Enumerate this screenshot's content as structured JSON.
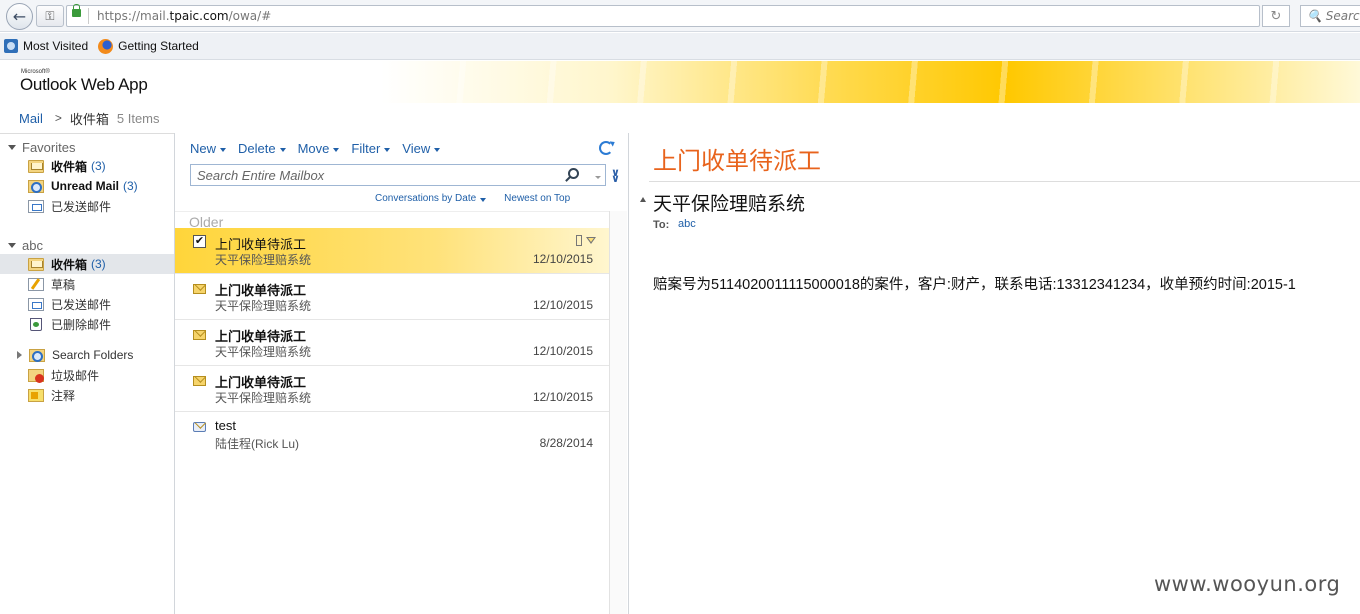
{
  "browser": {
    "url_prefix": "https://mail.",
    "url_domain": "tpaic.com",
    "url_suffix": "/owa/#",
    "search_placeholder": "Search",
    "bookmarks": [
      {
        "label": "Most Visited",
        "icon": "bookmark-icon"
      },
      {
        "label": "Getting Started",
        "icon": "firefox-icon"
      }
    ]
  },
  "owa": {
    "brand_small": "Microsoft®",
    "title": "Outlook Web App"
  },
  "breadcrumb": {
    "root": "Mail",
    "folder": "收件箱",
    "count": "5 Items"
  },
  "leftnav": {
    "favorites_header": "Favorites",
    "favorites": [
      {
        "label": "收件箱",
        "count": "(3)",
        "icon": "inbox-icon",
        "bold": true
      },
      {
        "label": "Unread Mail",
        "count": "(3)",
        "icon": "search-folder-icon",
        "bold": true
      },
      {
        "label": "已发送邮件",
        "count": "",
        "icon": "sent-icon",
        "bold": false
      }
    ],
    "account_header": "abc",
    "folders": [
      {
        "label": "收件箱",
        "count": "(3)",
        "icon": "inbox-icon",
        "bold": true,
        "selected": true
      },
      {
        "label": "草稿",
        "count": "",
        "icon": "drafts-icon"
      },
      {
        "label": "已发送邮件",
        "count": "",
        "icon": "sent-icon"
      },
      {
        "label": "已删除邮件",
        "count": "",
        "icon": "trash-icon"
      }
    ],
    "search_folders": "Search Folders",
    "junk": "垃圾邮件",
    "notes": "注释"
  },
  "toolbar": {
    "new": "New",
    "delete": "Delete",
    "move": "Move",
    "filter": "Filter",
    "view": "View",
    "search_placeholder": "Search Entire Mailbox",
    "sort_by": "Conversations by Date",
    "sort_order": "Newest on Top"
  },
  "list": {
    "group": "Older",
    "messages": [
      {
        "subject": "上门收单待派工",
        "sender": "天平保险理赔系统",
        "date": "12/10/2015",
        "unread": false,
        "selected": true
      },
      {
        "subject": "上门收单待派工",
        "sender": "天平保险理赔系统",
        "date": "12/10/2015",
        "unread": true
      },
      {
        "subject": "上门收单待派工",
        "sender": "天平保险理赔系统",
        "date": "12/10/2015",
        "unread": true
      },
      {
        "subject": "上门收单待派工",
        "sender": "天平保险理赔系统",
        "date": "12/10/2015",
        "unread": true
      },
      {
        "subject": "test",
        "sender": "陆佳程(Rick Lu)",
        "date": "8/28/2014",
        "unread": false
      }
    ]
  },
  "reading": {
    "subject": "上门收单待派工",
    "from": "天平保险理赔系统",
    "to_label": "To:",
    "to": "abc",
    "body": "赔案号为5114020011115000018的案件，客户:财产，联系电话:13312341234，收单预约时间:2015-1"
  },
  "watermark": "www.wooyun.org",
  "colors": {
    "accent_blue": "#1f5fa8",
    "subject_orange": "#e8631c",
    "selection_yellow": "#ffd53a"
  }
}
